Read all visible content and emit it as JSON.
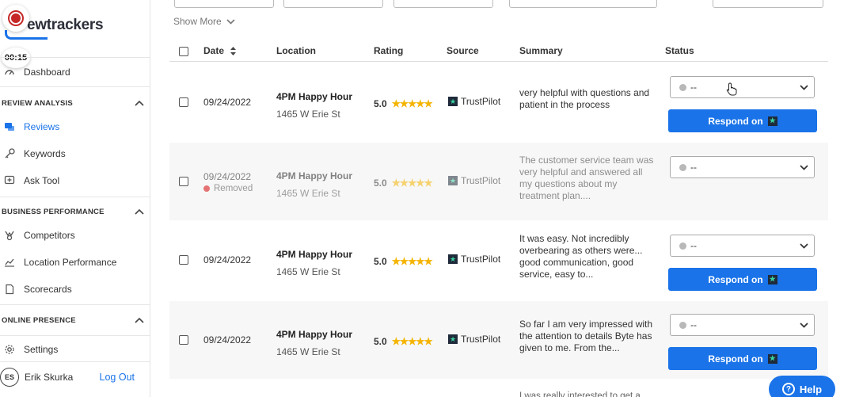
{
  "app": {
    "logo_text": "ewtrackers",
    "timer": "00:15"
  },
  "sidebar": {
    "dashboard": "Dashboard",
    "sections": [
      {
        "title": "REVIEW ANALYSIS",
        "items": [
          "Reviews",
          "Keywords",
          "Ask Tool"
        ]
      },
      {
        "title": "BUSINESS PERFORMANCE",
        "items": [
          "Competitors",
          "Location Performance",
          "Scorecards"
        ]
      },
      {
        "title": "ONLINE PRESENCE",
        "items": []
      }
    ],
    "settings": "Settings",
    "user": {
      "initials": "ES",
      "name": "Erik Skurka",
      "logout": "Log Out"
    }
  },
  "main": {
    "show_more": "Show More",
    "headers": {
      "date": "Date",
      "location": "Location",
      "rating": "Rating",
      "source": "Source",
      "summary": "Summary",
      "status": "Status"
    },
    "rows": [
      {
        "date": "09/24/2022",
        "location": "4PM Happy Hour",
        "address": "1465 W Erie St",
        "rating": "5.0",
        "source": "TrustPilot",
        "summary": "very helpful with questions and patient in the process",
        "status": "--",
        "respond": "Respond on",
        "removed": ""
      },
      {
        "date": "09/24/2022",
        "location": "4PM Happy Hour",
        "address": "1465 W Erie St",
        "rating": "5.0",
        "source": "TrustPilot",
        "summary": "The customer service team was very helpful and answered all my questions about my treatment plan....",
        "status": "--",
        "respond": "",
        "removed": "Removed"
      },
      {
        "date": "09/24/2022",
        "location": "4PM Happy Hour",
        "address": "1465 W Erie St",
        "rating": "5.0",
        "source": "TrustPilot",
        "summary": "It was easy. Not incredibly overbearing as others were... good communication, good service, easy to...",
        "status": "--",
        "respond": "Respond on",
        "removed": ""
      },
      {
        "date": "09/24/2022",
        "location": "4PM Happy Hour",
        "address": "1465 W Erie St",
        "rating": "5.0",
        "source": "TrustPilot",
        "summary": "So far I am very impressed with the attention to details Byte has given to me. From the...",
        "status": "--",
        "respond": "Respond on",
        "removed": ""
      }
    ],
    "partial_summary": "I was really interested to get a..."
  },
  "help": {
    "label": "Help"
  },
  "colors": {
    "accent": "#1a73e8",
    "star": "#f4b400",
    "removed": "#e57373"
  }
}
